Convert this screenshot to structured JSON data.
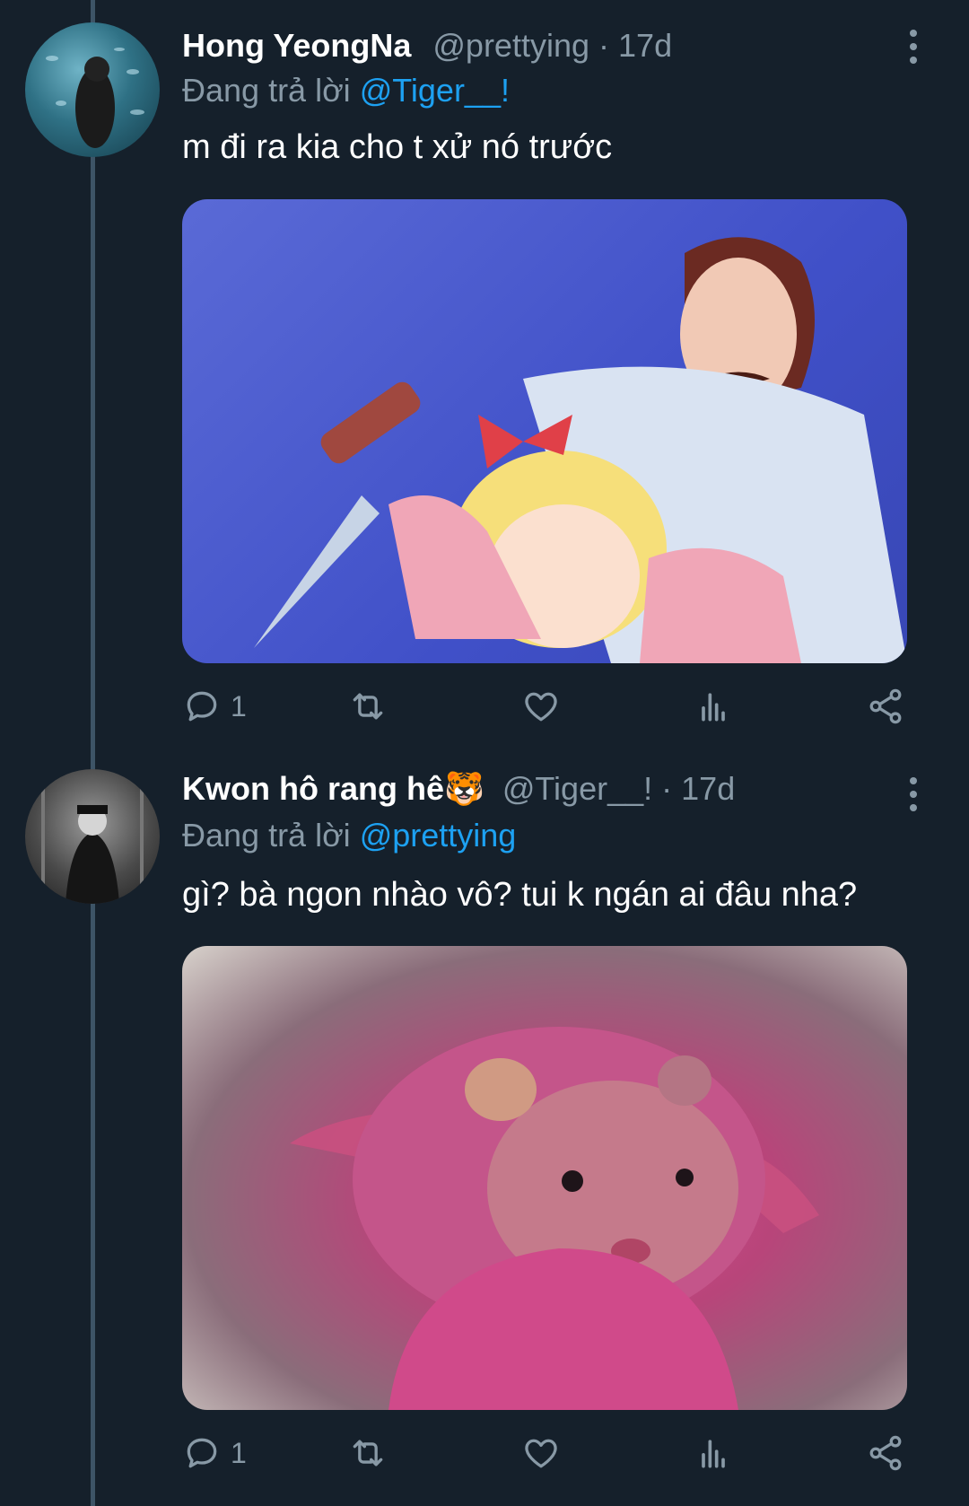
{
  "tweets": [
    {
      "name": "Hong YeongNa",
      "handle": "@prettying",
      "separator": "·",
      "age": "17d",
      "replying_prefix": "Đang trả lời",
      "replying_to": "@Tiger__!",
      "text": "m đi ra kia cho t xử nó trước",
      "media_icon": "cartoon-image",
      "reply_count": "1",
      "icons": [
        "reply-icon",
        "retweet-icon",
        "like-icon",
        "analytics-icon",
        "share-icon",
        "more-icon"
      ]
    },
    {
      "name": "Kwon hô rang hê🐯",
      "handle": "@Tiger__!",
      "separator": "·",
      "age": "17d",
      "replying_prefix": "Đang trả lời",
      "replying_to": "@prettying",
      "text": "gì? bà ngon nhào vô? tui k ngán ai đâu nha?",
      "media_icon": "hamster-image",
      "reply_count": "1",
      "icons": [
        "reply-icon",
        "retweet-icon",
        "like-icon",
        "analytics-icon",
        "share-icon",
        "more-icon"
      ]
    }
  ],
  "colors": {
    "background": "#15202b",
    "secondary_text": "#8899a6",
    "accent": "#1da1f2",
    "thread_line": "#3d5466"
  }
}
